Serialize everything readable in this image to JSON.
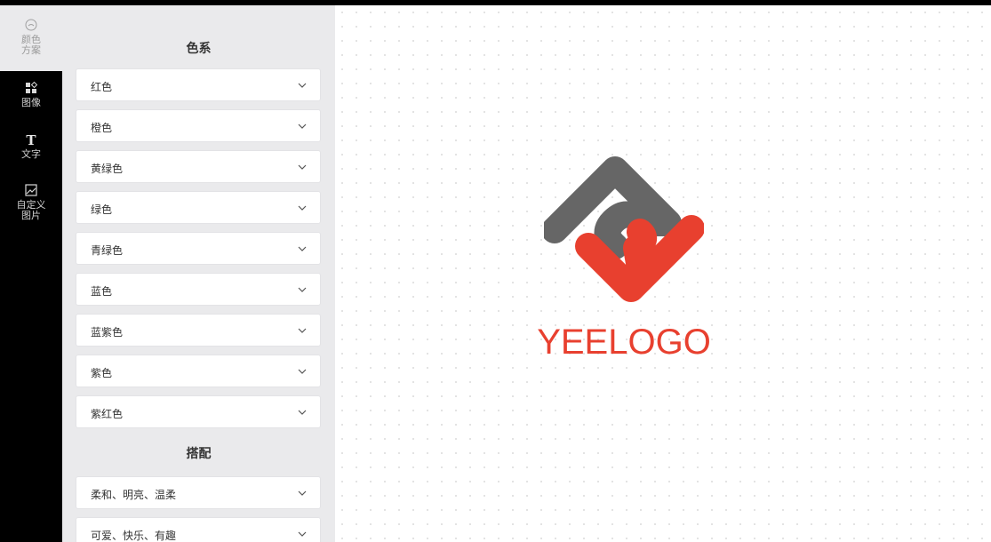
{
  "rail": {
    "items": [
      {
        "label": "颜色\n方案",
        "icon": "palette-icon"
      },
      {
        "label": "图像",
        "icon": "shapes-icon"
      },
      {
        "label": "文字",
        "icon": "text-icon"
      },
      {
        "label": "自定义\n图片",
        "icon": "image-icon"
      }
    ]
  },
  "panel": {
    "color_family_title": "色系",
    "colors": [
      "红色",
      "橙色",
      "黄绿色",
      "绿色",
      "青绿色",
      "蓝色",
      "蓝紫色",
      "紫色",
      "紫红色"
    ],
    "combo_title": "搭配",
    "combos": [
      "柔和、明亮、温柔",
      "可爱、快乐、有趣"
    ]
  },
  "logo": {
    "text": "YEELOGO",
    "gray_color": "#666666",
    "red_color": "#e8402f"
  }
}
